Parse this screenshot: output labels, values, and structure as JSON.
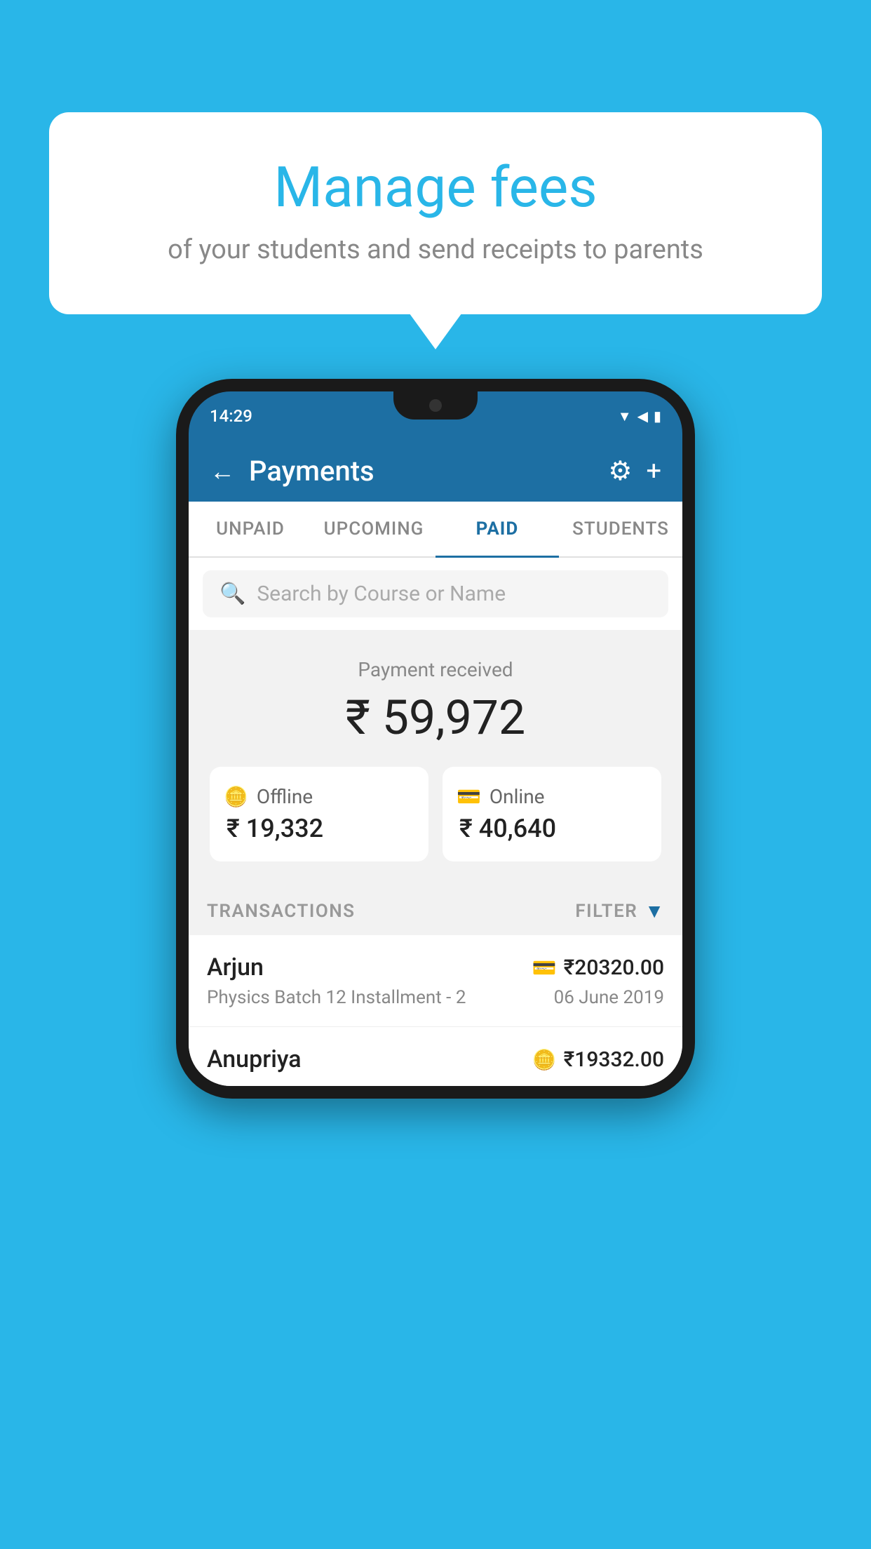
{
  "background_color": "#29b6e8",
  "bubble": {
    "title": "Manage fees",
    "subtitle": "of your students and send receipts to parents"
  },
  "phone": {
    "status_bar": {
      "time": "14:29",
      "icons": "▼ ◀ ▮"
    },
    "header": {
      "back_label": "←",
      "title": "Payments",
      "gear_icon": "gear",
      "plus_icon": "plus"
    },
    "tabs": [
      {
        "id": "unpaid",
        "label": "UNPAID",
        "active": false
      },
      {
        "id": "upcoming",
        "label": "UPCOMING",
        "active": false
      },
      {
        "id": "paid",
        "label": "PAID",
        "active": true
      },
      {
        "id": "students",
        "label": "STUDENTS",
        "active": false
      }
    ],
    "search": {
      "placeholder": "Search by Course or Name"
    },
    "payment_summary": {
      "label": "Payment received",
      "amount": "₹ 59,972",
      "offline": {
        "icon": "receipt",
        "label": "Offline",
        "amount": "₹ 19,332"
      },
      "online": {
        "icon": "card",
        "label": "Online",
        "amount": "₹ 40,640"
      }
    },
    "transactions": {
      "header_label": "TRANSACTIONS",
      "filter_label": "FILTER",
      "rows": [
        {
          "name": "Arjun",
          "payment_type_icon": "card",
          "amount": "₹20320.00",
          "course": "Physics Batch 12 Installment - 2",
          "date": "06 June 2019"
        },
        {
          "name": "Anupriya",
          "payment_type_icon": "receipt",
          "amount": "₹19332.00",
          "course": "",
          "date": ""
        }
      ]
    }
  }
}
